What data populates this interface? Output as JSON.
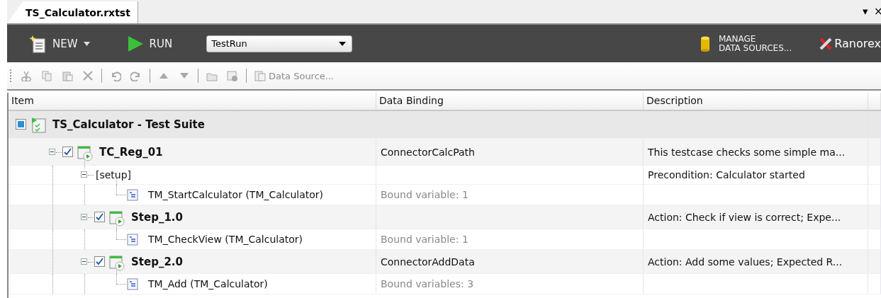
{
  "document_tab": {
    "title": "TS_Calculator.rxtst",
    "selected": true,
    "buttons": [
      "▾",
      "×"
    ]
  },
  "ribbon": {
    "new_button": "NEW",
    "run_button": "RUN",
    "run_config": "TestRun",
    "manage_button": [
      "MANAGE",
      "DATA SOURCES..."
    ],
    "brand": "Ranorex"
  },
  "toolbar": [
    {
      "kind": "cut",
      "disabled": true
    },
    {
      "kind": "copy",
      "disabled": true
    },
    {
      "kind": "paste",
      "disabled": true
    },
    {
      "kind": "delete",
      "disabled": true
    },
    {
      "kind": "undo",
      "disabled": true
    },
    {
      "kind": "redo",
      "disabled": true
    },
    {
      "kind": "up",
      "disabled": true
    },
    {
      "kind": "down",
      "disabled": true
    },
    {
      "kind": "folder",
      "disabled": true
    },
    {
      "kind": "play",
      "disabled": true
    },
    {
      "kind": "datasource",
      "disabled": true,
      "label": "Data Source..."
    }
  ],
  "table": {
    "columns": [
      "Item",
      "Data Binding",
      "Description"
    ],
    "rows": [
      {
        "kind": "suite",
        "name": "TS_Calculator - Test Suite",
        "checked": true,
        "children": [
          {
            "kind": "testcase",
            "name": "TC_Reg_01",
            "checked": true,
            "expanded": true,
            "binding": "ConnectorCalcPath",
            "description": "This testcase checks some simple ma...",
            "children": [
              {
                "kind": "setup",
                "name": "[setup]",
                "expanded": true,
                "description": "Precondition: Calculator started",
                "children": [
                  {
                    "kind": "module",
                    "name": "TM_StartCalculator (TM_Calculator)",
                    "binding": "Bound variable: 1"
                  }
                ]
              },
              {
                "kind": "step",
                "name": "Step_1.0",
                "checked": true,
                "expanded": true,
                "description": "Action: Check if view is correct; Expe...",
                "children": [
                  {
                    "kind": "module",
                    "name": "TM_CheckView (TM_Calculator)",
                    "binding": "Bound variable: 1"
                  }
                ]
              },
              {
                "kind": "step",
                "name": "Step_2.0",
                "checked": true,
                "expanded": true,
                "binding": "ConnectorAddData",
                "description": "Action: Add some values; Expected R...",
                "children": [
                  {
                    "kind": "module",
                    "name": "TM_Add (TM_Calculator)",
                    "binding": "Bound variables: 3"
                  }
                ]
              }
            ]
          }
        ]
      }
    ]
  }
}
